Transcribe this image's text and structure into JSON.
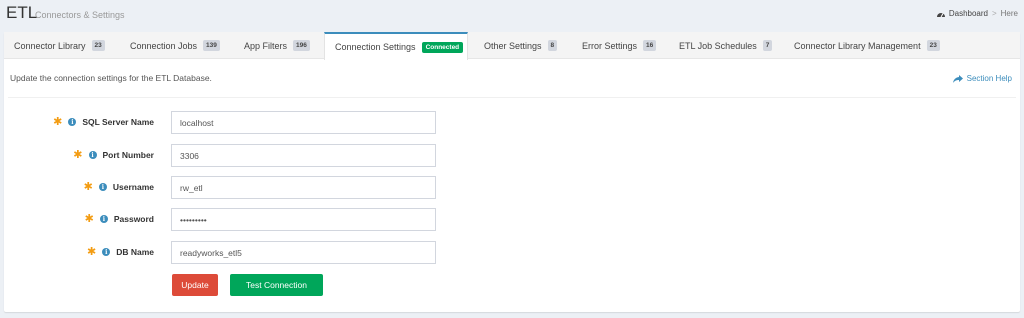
{
  "header": {
    "title": "ETL",
    "subtitle": "Connectors & Settings",
    "breadcrumb": {
      "dashboard": "Dashboard",
      "here": "Here",
      "separator": ">"
    }
  },
  "tabs": [
    {
      "label": "Connector Library",
      "badge": "23"
    },
    {
      "label": "Connection Jobs",
      "badge": "139"
    },
    {
      "label": "App Filters",
      "badge": "196"
    },
    {
      "label": "Connection Settings",
      "badge": "Connected",
      "active": true
    },
    {
      "label": "Other Settings",
      "badge": "8"
    },
    {
      "label": "Error Settings",
      "badge": "16"
    },
    {
      "label": "ETL Job Schedules",
      "badge": "7"
    },
    {
      "label": "Connector Library Management",
      "badge": "23"
    }
  ],
  "content": {
    "intro": "Update the connection settings for the ETL Database.",
    "help_label": "Section Help"
  },
  "form": {
    "required_mark": "✱",
    "info_mark": "i",
    "fields": [
      {
        "label": "SQL Server Name",
        "value": "localhost"
      },
      {
        "label": "Port Number",
        "value": "3306"
      },
      {
        "label": "Username",
        "value": "rw_etl"
      },
      {
        "label": "Password",
        "value": "•••••••••"
      },
      {
        "label": "DB Name",
        "value": "readyworks_etl5"
      }
    ],
    "update_label": "Update",
    "test_label": "Test Connection"
  },
  "colors": {
    "primary": "#3c8dbc",
    "success": "#00a65a",
    "danger": "#dd4b39",
    "required": "#f39c12"
  }
}
